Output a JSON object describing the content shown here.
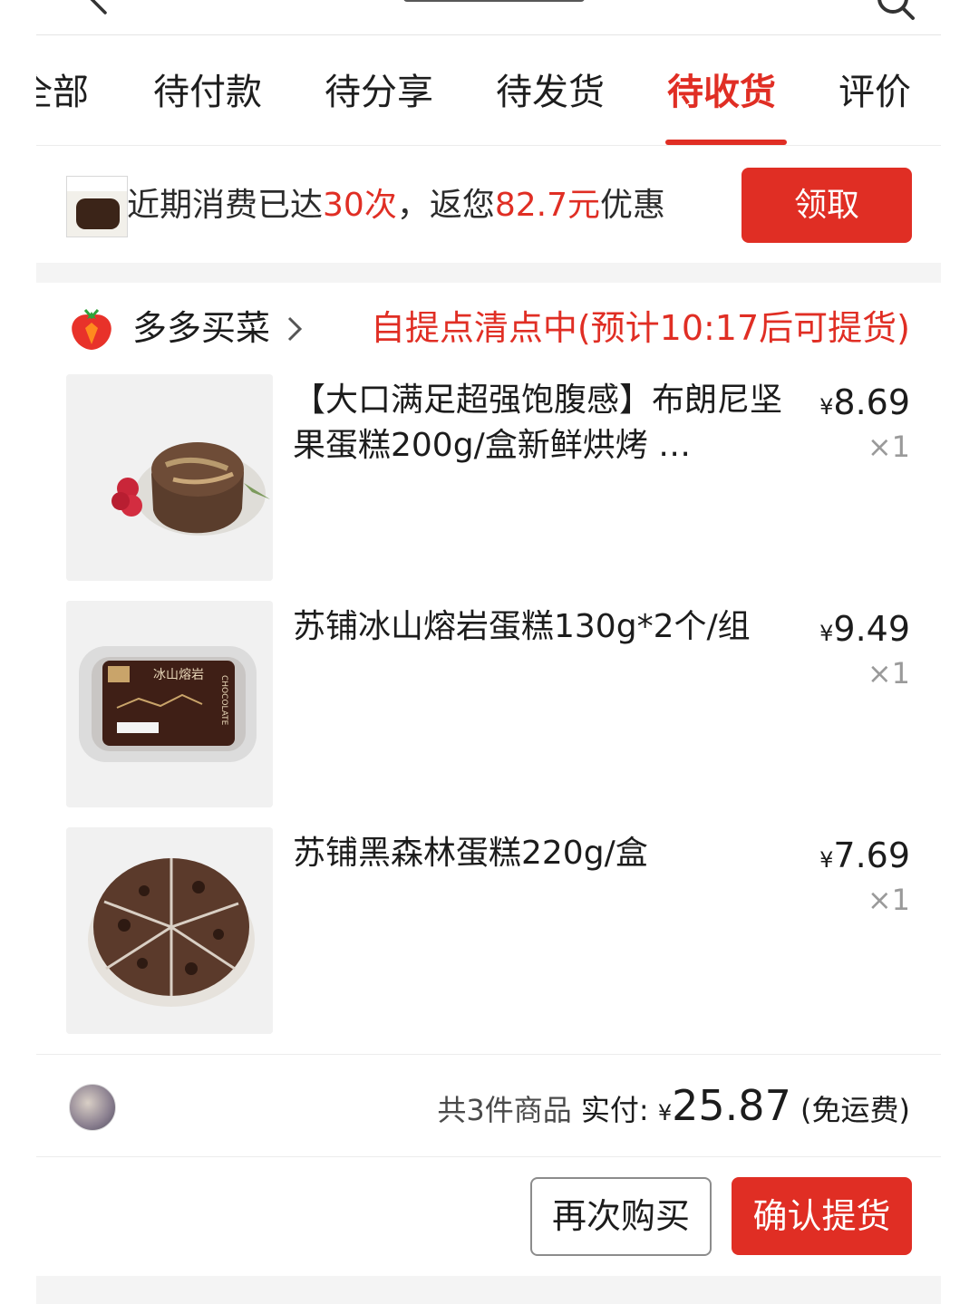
{
  "tabs": [
    {
      "label": "全部"
    },
    {
      "label": "待付款"
    },
    {
      "label": "待分享"
    },
    {
      "label": "待发货"
    },
    {
      "label": "待收货",
      "active": true
    },
    {
      "label": "评价"
    }
  ],
  "promo": {
    "text_before": "近期消费已达",
    "count": "30次",
    "text_middle": "，返您",
    "amount": "82.7元",
    "text_after": "优惠",
    "button_label": "领取"
  },
  "store": {
    "name": "多多买菜",
    "status": "自提点清点中(预计10:17后可提货)",
    "logo_icon": "strawberry-carrot-logo-icon"
  },
  "products": [
    {
      "name": "【大口满足超强饱腹感】布朗尼坚果蛋糕200g/盒新鲜烘烤 …",
      "currency": "¥",
      "price": "8.69",
      "qty": "×1"
    },
    {
      "name": "苏铺冰山熔岩蛋糕130g*2个/组",
      "currency": "¥",
      "price": "9.49",
      "qty": "×1"
    },
    {
      "name": "苏铺黑森林蛋糕220g/盒",
      "currency": "¥",
      "price": "7.69",
      "qty": "×1"
    }
  ],
  "summary": {
    "count_text": "共3件商品",
    "paid_label": "实付:",
    "currency": "¥",
    "total": "25.87",
    "shipping_note": "(免运费)"
  },
  "actions": {
    "rebuy_label": "再次购买",
    "confirm_label": "确认提货"
  },
  "package_label": "CHOCOLATE",
  "package_title": "冰山熔岩",
  "colors": {
    "accent": "#e02e24",
    "text": "#1c1c1c",
    "muted": "#9a9a9a",
    "divider": "#f4f4f4"
  }
}
